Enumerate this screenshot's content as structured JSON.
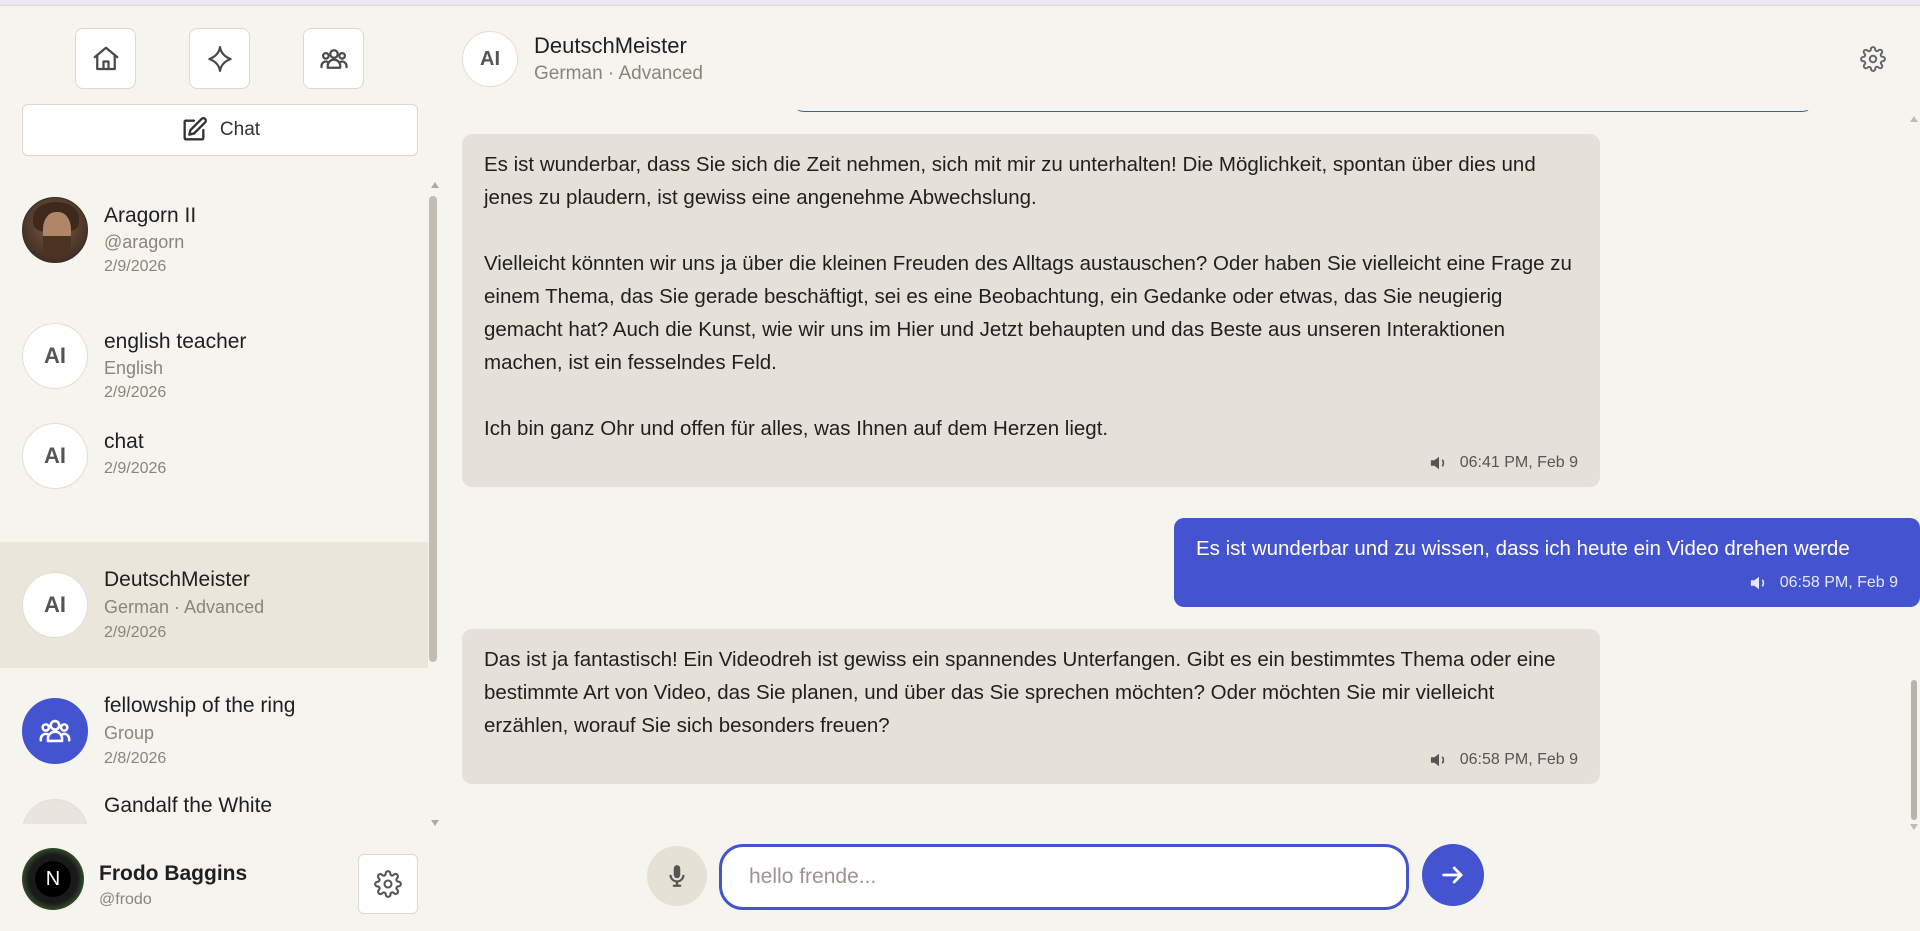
{
  "sidebar": {
    "nav": [
      {
        "icon": "home-icon"
      },
      {
        "icon": "sparkle-icon"
      },
      {
        "icon": "group-icon"
      }
    ],
    "new_chat_label": "Chat",
    "chats": [
      {
        "name": "Aragorn II",
        "sub": "@aragorn",
        "date": "2/9/2026",
        "avatar": "photo"
      },
      {
        "name": "english teacher",
        "sub": "English",
        "date": "2/9/2026",
        "avatar": "AI"
      },
      {
        "name": "chat",
        "sub": "",
        "date": "2/9/2026",
        "avatar": "AI"
      },
      {
        "name": "DeutschMeister",
        "sub": "German · Advanced",
        "date": "2/9/2026",
        "avatar": "AI",
        "active": true
      },
      {
        "name": "fellowship of the ring",
        "sub": "Group",
        "date": "2/8/2026",
        "avatar": "group"
      },
      {
        "name": "Gandalf the White",
        "sub": "",
        "date": "",
        "avatar": "photo"
      }
    ],
    "profile": {
      "initial": "N",
      "name": "Frodo Baggins",
      "handle": "@frodo"
    }
  },
  "header": {
    "avatar": "AI",
    "title": "DeutschMeister",
    "subtitle": "German · Advanced"
  },
  "messages": [
    {
      "role": "bot",
      "paragraphs": [
        "Es ist wunderbar, dass Sie sich die Zeit nehmen, sich mit mir zu unterhalten! Die Möglichkeit, spontan über dies und jenes zu plaudern, ist gewiss eine angenehme Abwechslung.",
        "Vielleicht könnten wir uns ja über die kleinen Freuden des Alltags austauschen? Oder haben Sie vielleicht eine Frage zu einem Thema, das Sie gerade beschäftigt, sei es eine Beobachtung, ein Gedanke oder etwas, das Sie neugierig gemacht hat? Auch die Kunst, wie wir uns im Hier und Jetzt behaupten und das Beste aus unseren Interaktionen machen, ist ein fesselndes Feld.",
        "Ich bin ganz Ohr und offen für alles, was Ihnen auf dem Herzen liegt."
      ],
      "time": "06:41 PM, Feb 9"
    },
    {
      "role": "user",
      "paragraphs": [
        "Es ist wunderbar und zu wissen, dass ich heute ein Video drehen werde"
      ],
      "time": "06:58 PM, Feb 9"
    },
    {
      "role": "bot",
      "paragraphs": [
        "Das ist ja fantastisch! Ein Videodreh ist gewiss ein spannendes Unterfangen. Gibt es ein bestimmtes Thema oder eine bestimmte Art von Video, das Sie planen, und über das Sie sprechen möchten? Oder möchten Sie mir vielleicht erzählen, worauf Sie sich besonders freuen?"
      ],
      "time": "06:58 PM, Feb 9"
    }
  ],
  "composer": {
    "placeholder": "hello frende...",
    "value": ""
  },
  "colors": {
    "accent": "#4453cf",
    "background": "#f6f4ef",
    "bot_bubble": "#e5e1d8",
    "active_item": "#ebe6dc"
  }
}
